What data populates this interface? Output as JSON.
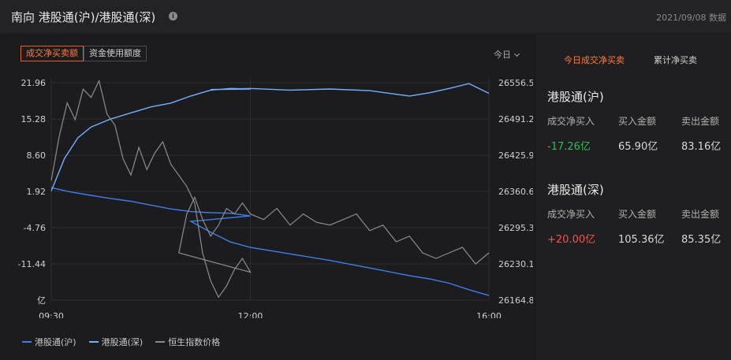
{
  "header": {
    "title": "南向 港股通(沪)/港股通(深)",
    "info_icon": "info-icon",
    "date": "2021/09/08 数据"
  },
  "tabs": [
    {
      "label": "成交净买卖额",
      "active": true
    },
    {
      "label": "资金使用额度",
      "active": false
    }
  ],
  "period": {
    "label": "今日"
  },
  "chart_data": {
    "type": "line",
    "x_ticks": [
      "09:30",
      "12:00",
      "16:00"
    ],
    "y_left": {
      "ticks": [
        "21.96",
        "15.28",
        "8.60",
        "1.92",
        "-4.76",
        "-11.44"
      ],
      "unit": "亿",
      "range": [
        -18.12,
        21.96
      ]
    },
    "y_right": {
      "ticks": [
        "26556.5",
        "26491.2",
        "26425.9",
        "26360.6",
        "26295.3",
        "26230.1",
        "26164.8"
      ],
      "range": [
        26164.8,
        26556.5
      ]
    },
    "grid": true,
    "legend_position": "bottom-left",
    "series": [
      {
        "name": "港股通(沪)",
        "color": "#3d7fe6",
        "axis": "left",
        "x": [
          "09:30",
          "09:45",
          "10:00",
          "10:15",
          "10:30",
          "10:45",
          "11:00",
          "11:15",
          "11:30",
          "11:45",
          "12:00",
          "12:15",
          "12:30",
          "12:45",
          "13:00",
          "13:30",
          "14:00",
          "14:30",
          "15:00",
          "15:15",
          "15:30",
          "15:45",
          "16:00"
        ],
        "y": [
          2.6,
          1.8,
          1.2,
          0.6,
          0.1,
          -0.6,
          -1.3,
          -1.8,
          -2.0,
          -2.1,
          -2.6,
          -3.6,
          -5.6,
          -7.4,
          -8.4,
          -9.6,
          -10.8,
          -12.2,
          -13.6,
          -14.2,
          -15.0,
          -16.2,
          -17.26
        ]
      },
      {
        "name": "港股通(深)",
        "color": "#6fb1ff",
        "axis": "left",
        "x": [
          "09:30",
          "09:40",
          "09:50",
          "10:00",
          "10:15",
          "10:30",
          "10:45",
          "11:00",
          "11:15",
          "11:30",
          "11:45",
          "12:00",
          "12:30",
          "13:00",
          "13:30",
          "14:00",
          "14:30",
          "15:00",
          "15:15",
          "15:30",
          "15:45",
          "16:00"
        ],
        "y": [
          2.0,
          8.0,
          11.8,
          13.8,
          15.3,
          16.4,
          17.5,
          18.2,
          19.5,
          20.6,
          20.9,
          20.8,
          20.7,
          20.9,
          20.6,
          20.8,
          20.5,
          19.5,
          20.1,
          20.9,
          21.8,
          20.0
        ]
      },
      {
        "name": "恒生指数价格",
        "color": "#8c8c8c",
        "axis": "right",
        "x": [
          "09:30",
          "09:36",
          "09:42",
          "09:48",
          "09:54",
          "10:00",
          "10:06",
          "10:12",
          "10:18",
          "10:24",
          "10:30",
          "10:36",
          "10:42",
          "10:48",
          "10:54",
          "11:00",
          "11:06",
          "11:12",
          "11:18",
          "11:24",
          "11:30",
          "11:36",
          "11:42",
          "11:48",
          "11:54",
          "12:00",
          "12:06",
          "12:12",
          "12:18",
          "12:24",
          "12:30",
          "12:36",
          "12:42",
          "12:48",
          "12:54",
          "13:00",
          "13:10",
          "13:20",
          "13:30",
          "13:40",
          "13:50",
          "14:00",
          "14:10",
          "14:20",
          "14:30",
          "14:40",
          "14:50",
          "15:00",
          "15:10",
          "15:20",
          "15:30",
          "15:40",
          "15:50",
          "16:00"
        ],
        "y": [
          26380,
          26460,
          26520,
          26490,
          26545,
          26530,
          26560,
          26500,
          26480,
          26420,
          26390,
          26440,
          26400,
          26430,
          26450,
          26410,
          26390,
          26370,
          26340,
          26250,
          26200,
          26170,
          26190,
          26220,
          26240,
          26215,
          26250,
          26320,
          26350,
          26310,
          26280,
          26300,
          26330,
          26320,
          26340,
          26320,
          26310,
          26330,
          26300,
          26320,
          26305,
          26300,
          26310,
          26320,
          26290,
          26300,
          26270,
          26280,
          26250,
          26240,
          26250,
          26260,
          26230,
          26250
        ]
      }
    ]
  },
  "legend": [
    {
      "label": "港股通(沪)",
      "color": "#3d7fe6"
    },
    {
      "label": "港股通(深)",
      "color": "#6fb1ff"
    },
    {
      "label": "恒生指数价格",
      "color": "#8c8c8c"
    }
  ],
  "right_tabs": [
    {
      "label": "今日成交净买卖",
      "active": true
    },
    {
      "label": "累计净买卖",
      "active": false
    }
  ],
  "sections": [
    {
      "title": "港股通(沪)",
      "labels": [
        "成交净买入",
        "买入金额",
        "卖出金额"
      ],
      "values": [
        "-17.26亿",
        "65.90亿",
        "83.16亿"
      ],
      "net_color": "#2fbf4f"
    },
    {
      "title": "港股通(深)",
      "labels": [
        "成交净买入",
        "买入金额",
        "卖出金额"
      ],
      "values": [
        "+20.00亿",
        "105.36亿",
        "85.35亿"
      ],
      "net_color": "#ff4d4d"
    }
  ]
}
